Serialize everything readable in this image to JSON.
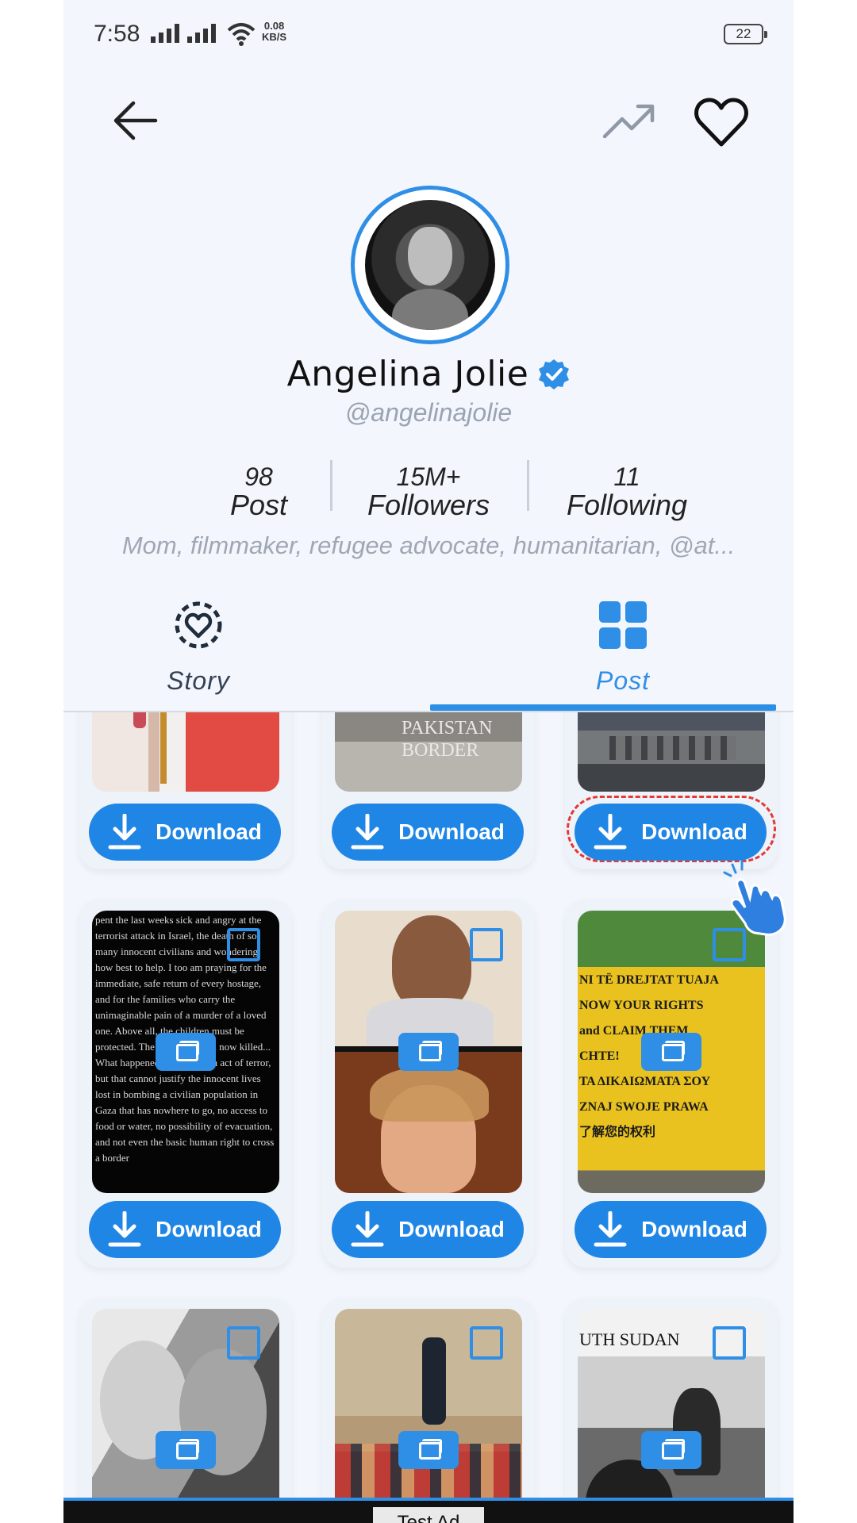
{
  "status_bar": {
    "time": "7:58",
    "net_speed_value": "0.08",
    "net_speed_unit": "KB/S",
    "battery": "22"
  },
  "top_bar": {
    "back_icon": "arrow-left-icon",
    "trending_icon": "trending-up-icon",
    "favorite_icon": "heart-outline-icon"
  },
  "profile": {
    "name": "Angelina Jolie",
    "handle": "@angelinajolie",
    "verified_icon": "verified-badge-icon",
    "bio": "Mom, filmmaker, refugee advocate, humanitarian, @at..."
  },
  "stats": [
    {
      "value": "98",
      "label": "Post"
    },
    {
      "value": "15M+",
      "label": "Followers"
    },
    {
      "value": "11",
      "label": "Following"
    }
  ],
  "tabs": [
    {
      "label": "Story",
      "icon": "story-heart-icon",
      "active": false
    },
    {
      "label": "Post",
      "icon": "grid-icon",
      "active": true
    }
  ],
  "grid": {
    "download_label": "Download",
    "rows": [
      {
        "items": [
          {
            "text": ""
          },
          {
            "text": "PAKISTAN\nBORDER"
          },
          {
            "text": ""
          }
        ]
      },
      {
        "items": [
          {
            "text": "pent the last weeks sick and angry at the terrorist attack in Israel, the death of so many innocent civilians and wondering how best to help. I too am praying for the immediate, safe return of every hostage, and for the families who carry the unimaginable pain of a murder of a loved one. Above all, the children must be protected. The many children now killed... What happened in Israel is an act of terror, but that cannot justify the innocent lives lost in bombing a civilian population in Gaza that has nowhere to go, no access to food or water, no possibility of evacuation, and not even the basic human right to cross a border"
          },
          {
            "text": ""
          },
          {
            "text": "NI TË DREJTAT TUAJA\nNOW YOUR RIGHTS\nand CLAIM THEM\nCHTE!\nΤΑ ΔΙΚΑΙΩΜΑΤΑ ΣΟΥ\nZNAJ SWOJE PRAWA\n了解您的权利"
          }
        ]
      },
      {
        "items": [
          {
            "text": ""
          },
          {
            "text": ""
          },
          {
            "text": "UTH SUDAN"
          }
        ]
      }
    ]
  },
  "ad": {
    "label": "Test Ad"
  },
  "colors": {
    "accent": "#2f8ee6",
    "button": "#2086e6",
    "background": "#f3f6fc",
    "highlight": "#e53935"
  }
}
